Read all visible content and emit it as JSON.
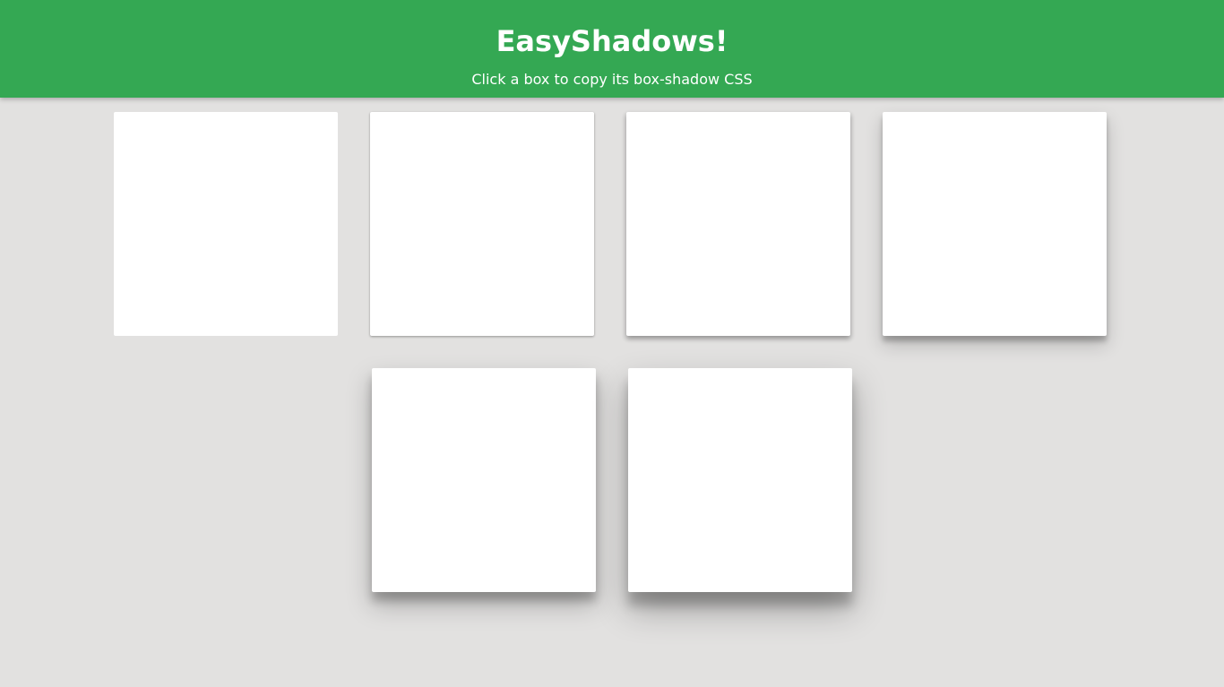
{
  "header": {
    "title": "EasyShadows!",
    "subtitle": "Click a box to copy its box-shadow CSS"
  },
  "colors": {
    "header_bg": "#34a853",
    "page_bg": "#e2e1e0",
    "card_bg": "#ffffff"
  },
  "boxes": [
    {
      "level": 0
    },
    {
      "level": 1
    },
    {
      "level": 2
    },
    {
      "level": 3
    },
    {
      "level": 4
    },
    {
      "level": 5
    }
  ]
}
